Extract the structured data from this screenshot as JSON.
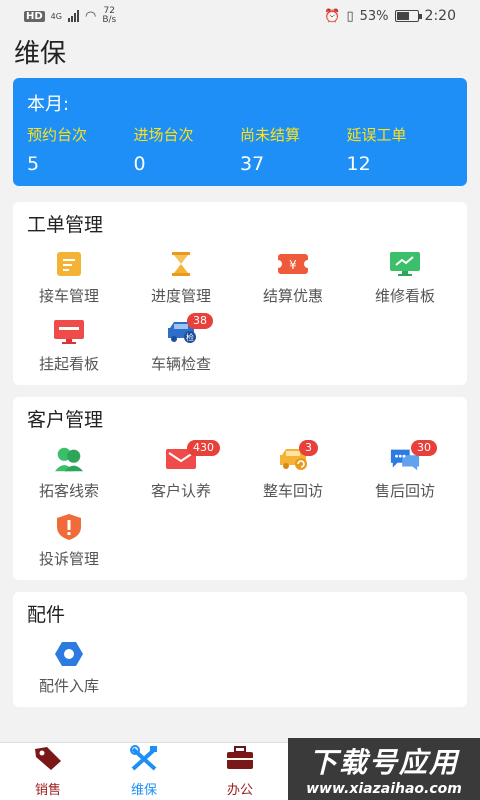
{
  "status": {
    "net": "HD",
    "gen": "4G",
    "speed_num": "72",
    "speed_unit": "B/s",
    "battery": "53%",
    "time": "2:20"
  },
  "page": {
    "title": "维保"
  },
  "stats": {
    "period": "本月:",
    "items": [
      {
        "label": "预约台次",
        "value": "5"
      },
      {
        "label": "进场台次",
        "value": "0"
      },
      {
        "label": "尚未结算",
        "value": "37"
      },
      {
        "label": "延误工单",
        "value": "12"
      }
    ]
  },
  "workorder": {
    "title": "工单管理",
    "items": [
      {
        "label": "接车管理",
        "icon": "clipboard-icon"
      },
      {
        "label": "进度管理",
        "icon": "hourglass-icon"
      },
      {
        "label": "结算优惠",
        "icon": "coupon-icon"
      },
      {
        "label": "维修看板",
        "icon": "monitor-chart-icon"
      },
      {
        "label": "挂起看板",
        "icon": "monitor-icon"
      },
      {
        "label": "车辆检查",
        "icon": "car-check-icon",
        "badge": "38"
      }
    ]
  },
  "customer": {
    "title": "客户管理",
    "items": [
      {
        "label": "拓客线索",
        "icon": "users-icon"
      },
      {
        "label": "客户认养",
        "icon": "envelope-icon",
        "badge": "430"
      },
      {
        "label": "整车回访",
        "icon": "car-return-icon",
        "badge": "3"
      },
      {
        "label": "售后回访",
        "icon": "chat-icon",
        "badge": "30"
      },
      {
        "label": "投诉管理",
        "icon": "warning-shield-icon"
      }
    ]
  },
  "parts": {
    "title": "配件",
    "items": [
      {
        "label": "配件入库",
        "icon": "hex-nut-icon"
      }
    ]
  },
  "nav": {
    "items": [
      {
        "label": "销售",
        "icon": "tag-icon",
        "color": "#9e1b1b"
      },
      {
        "label": "维保",
        "icon": "tools-icon",
        "color": "#1e8ff7"
      },
      {
        "label": "办公",
        "icon": "briefcase-icon",
        "color": "#9e1b1b"
      }
    ]
  },
  "watermark": {
    "line1": "下载号应用",
    "line2": "www.xiazaihao.com"
  },
  "colors": {
    "accent": "#1e8ff7",
    "stat_label": "#ffe11a",
    "badge": "#e8413b"
  }
}
